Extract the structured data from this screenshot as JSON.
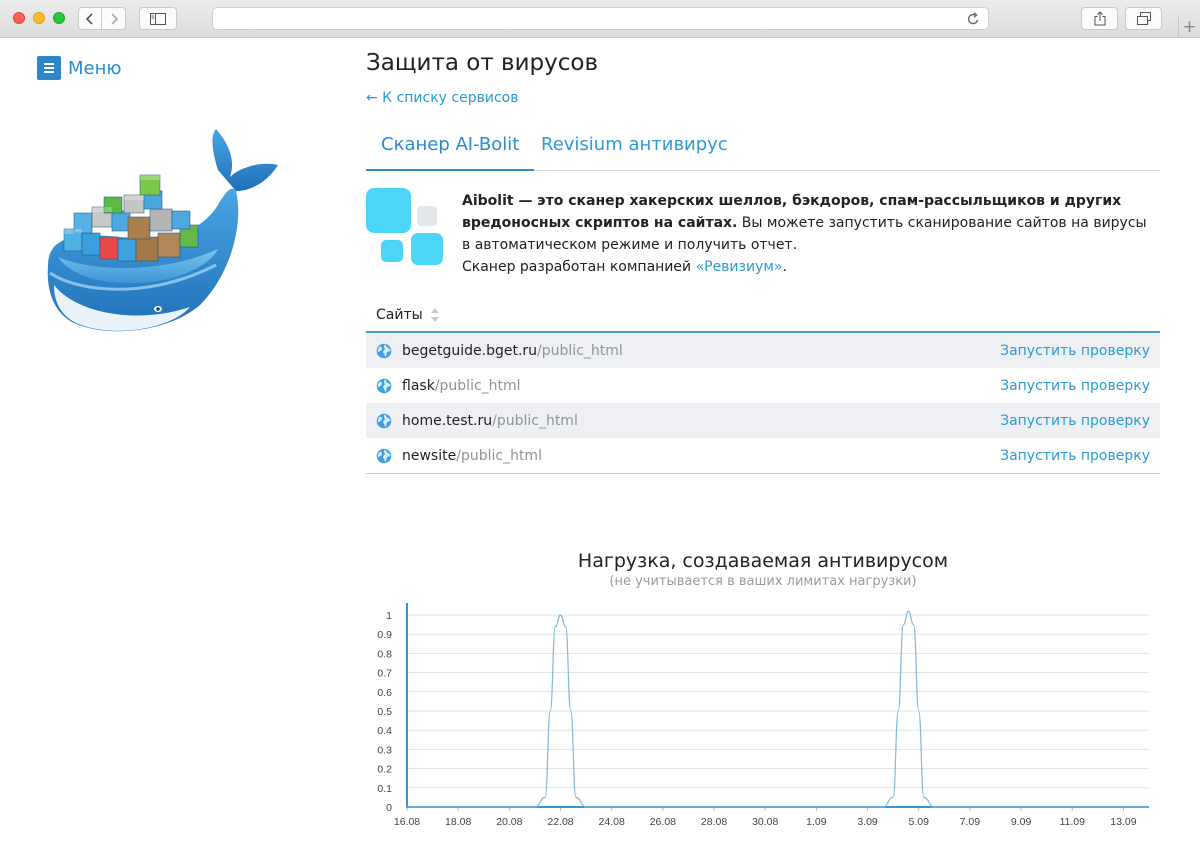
{
  "sidebar": {
    "menu_label": "Меню"
  },
  "page": {
    "title": "Защита от вирусов",
    "back_link": "← К списку сервисов"
  },
  "tabs": [
    {
      "label": "Сканер AI-Bolit",
      "active": true
    },
    {
      "label": "Revisium антивирус",
      "active": false
    }
  ],
  "description": {
    "bold": "Aibolit — это сканер хакерских шеллов, бэкдоров, спам-рассыльщиков и других вредоносных скриптов на сайтах.",
    "text": " Вы можете запустить сканирование сайтов на вирусы в автоматическом режиме и получить отчет.",
    "developer_prefix": "Сканер разработан компанией ",
    "developer_link": "«Ревизиум»",
    "developer_suffix": "."
  },
  "sites_table": {
    "header": "Сайты",
    "action_label": "Запустить проверку",
    "rows": [
      {
        "host": "begetguide.bget.ru",
        "path": "/public_html"
      },
      {
        "host": "flask",
        "path": "/public_html"
      },
      {
        "host": "home.test.ru",
        "path": "/public_html"
      },
      {
        "host": "newsite",
        "path": "/public_html"
      }
    ]
  },
  "chart_data": {
    "type": "line",
    "title": "Нагрузка, создаваемая антивирусом",
    "subtitle": "(не учитывается в ваших лимитах нагрузки)",
    "xlabel": "",
    "ylabel": "",
    "x_ticks": [
      "16.08",
      "18.08",
      "20.08",
      "22.08",
      "24.08",
      "26.08",
      "28.08",
      "30.08",
      "1.09",
      "3.09",
      "5.09",
      "7.09",
      "9.09",
      "11.09",
      "13.09"
    ],
    "y_ticks": [
      "0",
      "0.1",
      "0.2",
      "0.3",
      "0.4",
      "0.5",
      "0.6",
      "0.7",
      "0.8",
      "0.9",
      "1"
    ],
    "ylim": [
      0,
      1
    ],
    "x_range_days": [
      0,
      29
    ],
    "grid": true,
    "series": [
      {
        "x": [
          0,
          5,
          5.4,
          5.6,
          5.8,
          6.0,
          6.2,
          6.4,
          6.6,
          7.0,
          18.6,
          19.0,
          19.2,
          19.4,
          19.6,
          19.8,
          20.0,
          20.2,
          20.6,
          29
        ],
        "y": [
          0,
          0,
          0.05,
          0.5,
          0.94,
          1.0,
          0.94,
          0.5,
          0.05,
          0,
          0,
          0.05,
          0.5,
          0.95,
          1.02,
          0.95,
          0.5,
          0.05,
          0,
          0
        ]
      }
    ],
    "colors": {
      "line": "#7fb8e0",
      "axis": "#3a93d3",
      "grid": "#e3e3e3"
    }
  }
}
